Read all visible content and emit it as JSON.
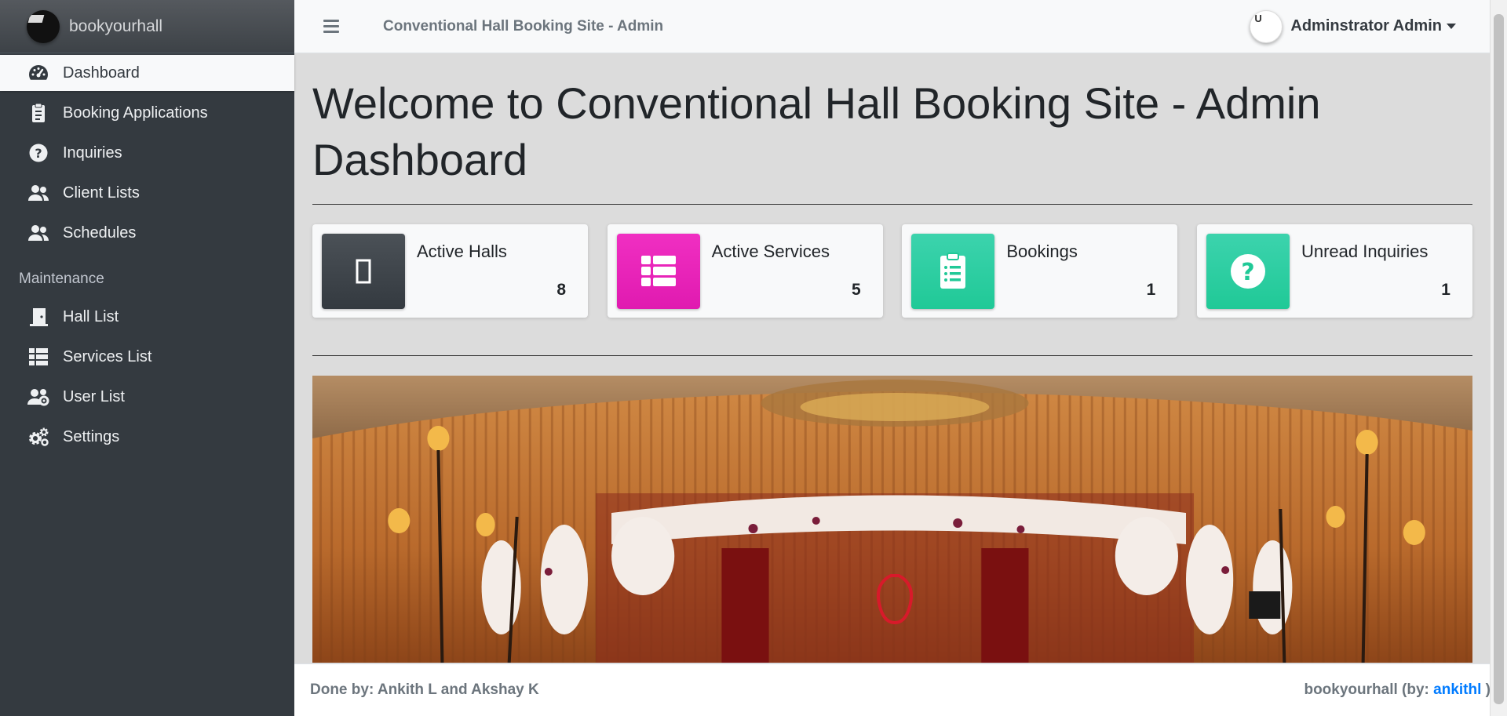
{
  "brand": {
    "name": "bookyourhall"
  },
  "sidebar": {
    "items": [
      {
        "label": "Dashboard",
        "icon": "dashboard-gauge-icon",
        "active": true
      },
      {
        "label": "Booking Applications",
        "icon": "clipboard-icon"
      },
      {
        "label": "Inquiries",
        "icon": "question-circle-icon"
      },
      {
        "label": "Client Lists",
        "icon": "users-icon"
      },
      {
        "label": "Schedules",
        "icon": "users-icon"
      }
    ],
    "maintenance_header": "Maintenance",
    "maintenance_items": [
      {
        "label": "Hall List",
        "icon": "door-open-icon"
      },
      {
        "label": "Services List",
        "icon": "list-icon"
      },
      {
        "label": "User List",
        "icon": "users-cog-icon"
      },
      {
        "label": "Settings",
        "icon": "cogs-icon"
      }
    ]
  },
  "topbar": {
    "title": "Conventional Hall Booking Site - Admin",
    "user_name": "Adminstrator Admin",
    "avatar_alt": "U"
  },
  "main": {
    "heading": "Welcome to Conventional Hall Booking Site - Admin Dashboard",
    "cards": [
      {
        "label": "Active Halls",
        "value": "8",
        "icon": "building-icon",
        "color": "#343a40"
      },
      {
        "label": "Active Services",
        "value": "5",
        "icon": "th-list-icon",
        "color": "#e83e8c"
      },
      {
        "label": "Bookings",
        "value": "1",
        "icon": "clipboard-list-icon",
        "color": "#20c997"
      },
      {
        "label": "Unread Inquiries",
        "value": "1",
        "icon": "question-circle-icon",
        "color": "#20c997"
      }
    ]
  },
  "footer": {
    "left": "Done by: Ankith L and Akshay K",
    "right_prefix": "bookyourhall (by: ",
    "right_link": "ankithl",
    "right_suffix": " )"
  },
  "colors": {
    "sidebar": "#343a40",
    "link": "#007bff"
  }
}
